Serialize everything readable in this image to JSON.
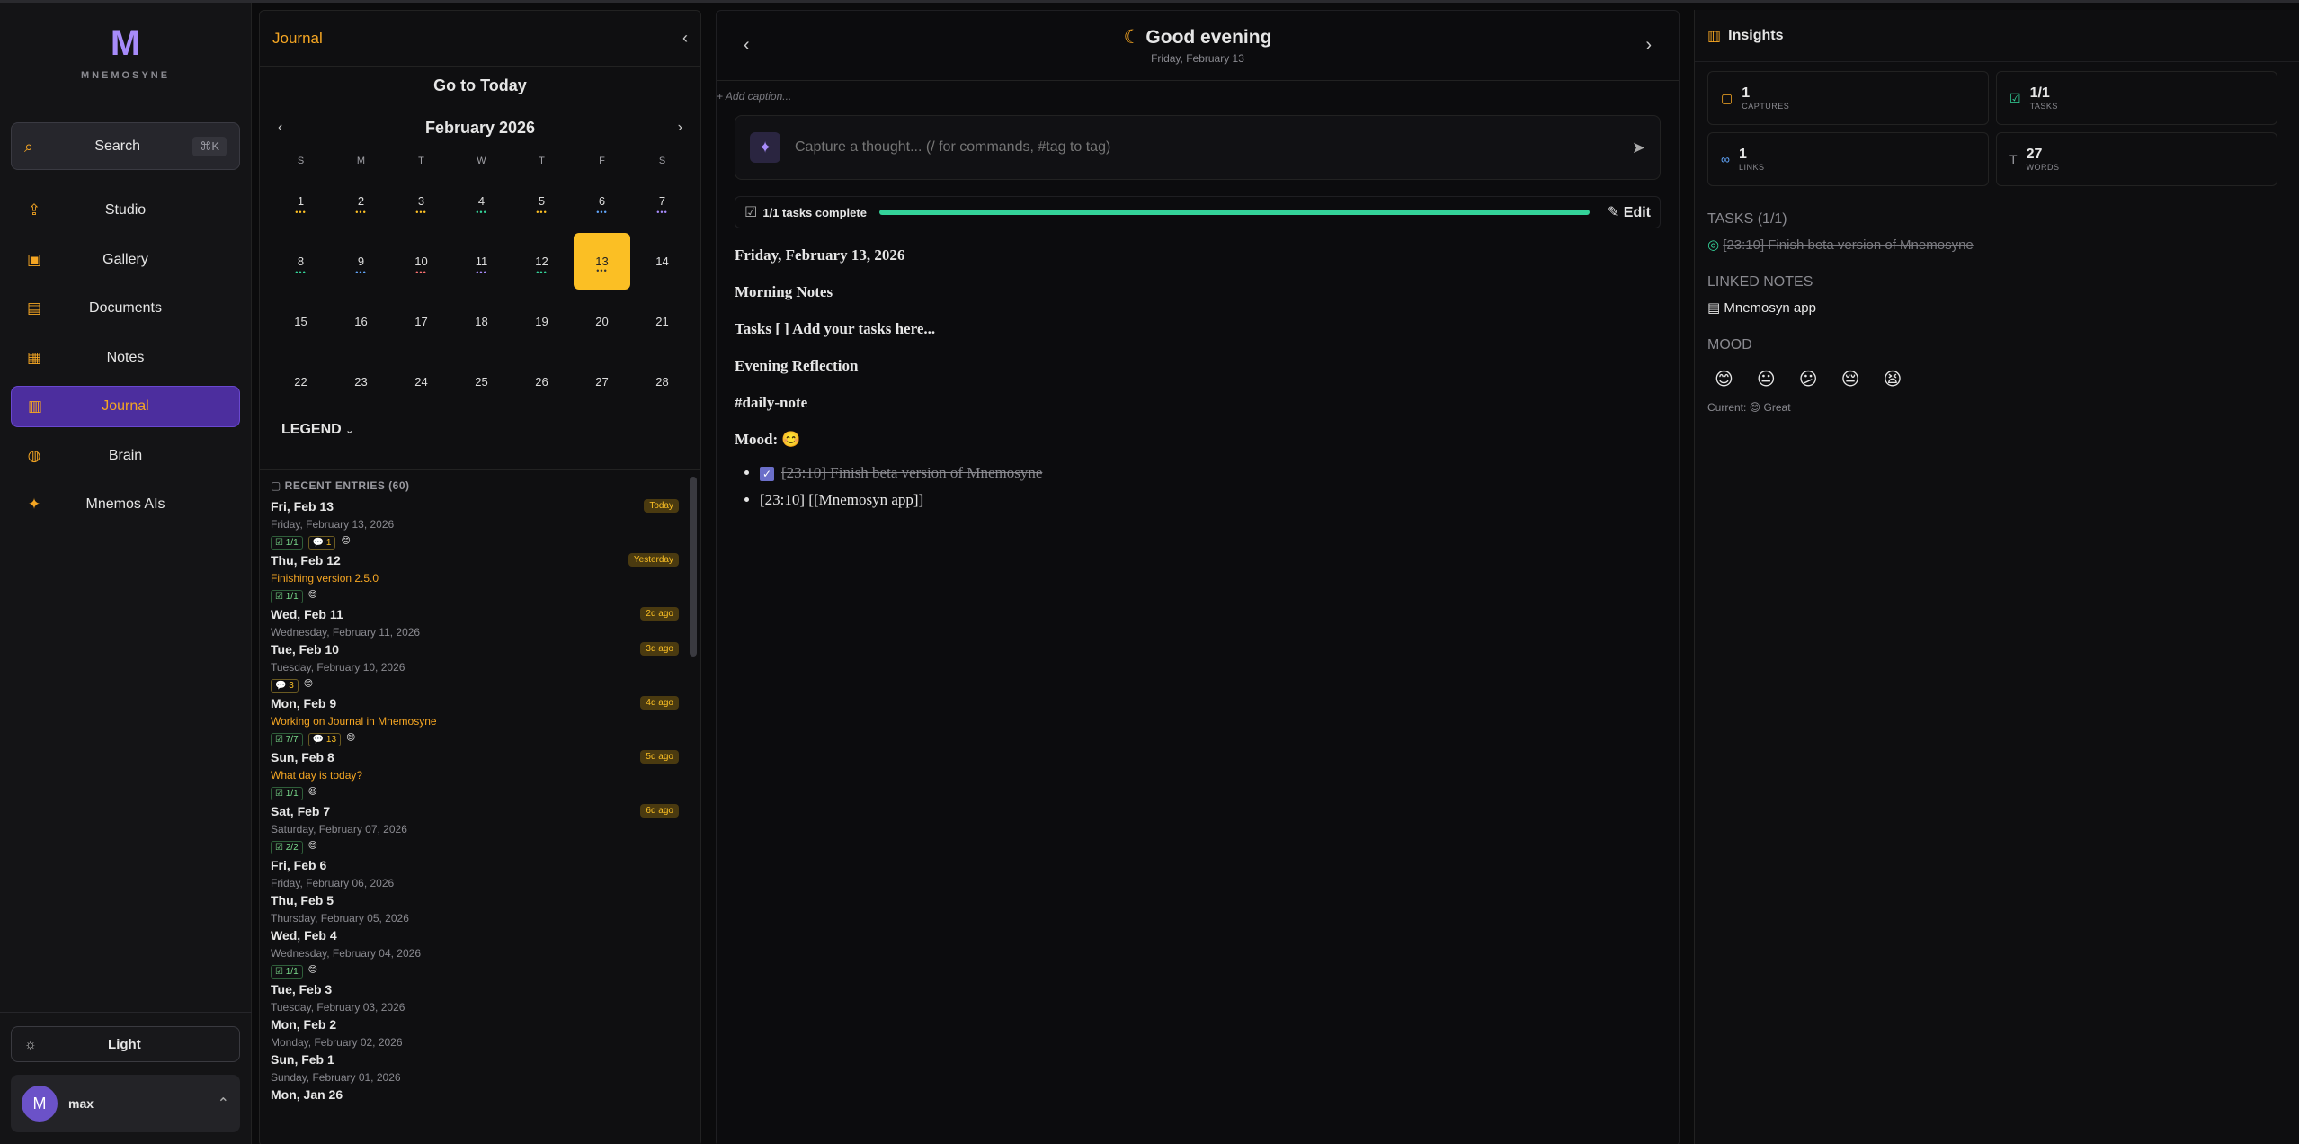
{
  "brand": {
    "logo": "M",
    "name": "MNEMOSYNE"
  },
  "search": {
    "label": "Search",
    "shortcut": "⌘K"
  },
  "nav": [
    {
      "label": "Studio",
      "icon": "upload-icon"
    },
    {
      "label": "Gallery",
      "icon": "image-icon"
    },
    {
      "label": "Documents",
      "icon": "document-icon"
    },
    {
      "label": "Notes",
      "icon": "notes-icon"
    },
    {
      "label": "Journal",
      "icon": "book-icon"
    },
    {
      "label": "Brain",
      "icon": "brain-icon"
    },
    {
      "label": "Mnemos AIs",
      "icon": "sparkle-icon"
    }
  ],
  "theme_toggle": "Light",
  "user": {
    "initial": "M",
    "name": "max"
  },
  "journal": {
    "title": "Journal",
    "go_today": "Go to Today",
    "month": "February 2026",
    "dow": [
      "S",
      "M",
      "T",
      "W",
      "T",
      "F",
      "S"
    ],
    "days": [
      "1",
      "2",
      "3",
      "4",
      "5",
      "6",
      "7",
      "8",
      "9",
      "10",
      "11",
      "12",
      "13",
      "14",
      "15",
      "16",
      "17",
      "18",
      "19",
      "20",
      "21",
      "22",
      "23",
      "24",
      "25",
      "26",
      "27",
      "28"
    ],
    "selected_day": "13",
    "legend": "LEGEND",
    "recent_header": "RECENT ENTRIES (60)",
    "entries": [
      {
        "date": "Fri, Feb 13",
        "sub": "Friday, February 13, 2026",
        "badge": "Today",
        "chips": [
          "☑ 1/1",
          "💬 1",
          "😊"
        ]
      },
      {
        "date": "Thu, Feb 12",
        "sub": "Finishing version 2.5.0",
        "badge": "Yesterday",
        "chips": [
          "☑ 1/1",
          "😊"
        ]
      },
      {
        "date": "Wed, Feb 11",
        "sub": "Wednesday, February 11, 2026",
        "badge": "2d ago",
        "chips": []
      },
      {
        "date": "Tue, Feb 10",
        "sub": "Tuesday, February 10, 2026",
        "badge": "3d ago",
        "chips": [
          "💬 3",
          "😊"
        ]
      },
      {
        "date": "Mon, Feb 9",
        "sub": "Working on Journal in Mnemosyne",
        "badge": "4d ago",
        "chips": [
          "☑ 7/7",
          "💬 13",
          "😊"
        ]
      },
      {
        "date": "Sun, Feb 8",
        "sub": "What day is today?",
        "badge": "5d ago",
        "chips": [
          "☑ 1/1",
          "😆"
        ]
      },
      {
        "date": "Sat, Feb 7",
        "sub": "Saturday, February 07, 2026",
        "badge": "6d ago",
        "chips": [
          "☑ 2/2",
          "😊"
        ]
      },
      {
        "date": "Fri, Feb 6",
        "sub": "Friday, February 06, 2026",
        "badge": "",
        "chips": []
      },
      {
        "date": "Thu, Feb 5",
        "sub": "Thursday, February 05, 2026",
        "badge": "",
        "chips": []
      },
      {
        "date": "Wed, Feb 4",
        "sub": "Wednesday, February 04, 2026",
        "badge": "",
        "chips": [
          "☑ 1/1",
          "😊"
        ]
      },
      {
        "date": "Tue, Feb 3",
        "sub": "Tuesday, February 03, 2026",
        "badge": "",
        "chips": []
      },
      {
        "date": "Mon, Feb 2",
        "sub": "Monday, February 02, 2026",
        "badge": "",
        "chips": []
      },
      {
        "date": "Sun, Feb 1",
        "sub": "Sunday, February 01, 2026",
        "badge": "",
        "chips": []
      },
      {
        "date": "Mon, Jan 26",
        "sub": "",
        "badge": "",
        "chips": []
      }
    ]
  },
  "main": {
    "greeting": "Good evening",
    "date": "Friday, February 13",
    "caption": "+ Add caption...",
    "capture_placeholder": "Capture a thought... (/ for commands, #tag to tag)",
    "tasks_complete": "1/1 tasks complete",
    "progress": 1.0,
    "edit": "Edit",
    "doc": {
      "lines": [
        "Friday, February 13, 2026",
        "Morning Notes",
        "Tasks [ ] Add your tasks here...",
        "Evening Reflection",
        "#daily-note",
        "Mood: 😊"
      ],
      "task_done": "[23:10] Finish beta version of Mnemosyne",
      "link_item": "[23:10] [[Mnemosyn app]]"
    }
  },
  "insights": {
    "title": "Insights",
    "stats": [
      {
        "value": "1",
        "label": "CAPTURES",
        "icon": "comment-icon",
        "color": "#f5a623"
      },
      {
        "value": "1/1",
        "label": "TASKS",
        "icon": "check-square-icon",
        "color": "#34d399"
      },
      {
        "value": "1",
        "label": "LINKS",
        "icon": "link-icon",
        "color": "#60a5fa"
      },
      {
        "value": "27",
        "label": "WORDS",
        "icon": "text-icon",
        "color": "#9a9aa0"
      }
    ],
    "tasks_header": "TASKS (1/1)",
    "task": "[23:10] Finish beta version of Mnemosyne",
    "linked_header": "LINKED NOTES",
    "linked": "Mnemosyn app",
    "mood_header": "MOOD",
    "moods": [
      "😊",
      "😐",
      "😕",
      "😔",
      "😫"
    ],
    "current": "Current: 😊 Great"
  }
}
